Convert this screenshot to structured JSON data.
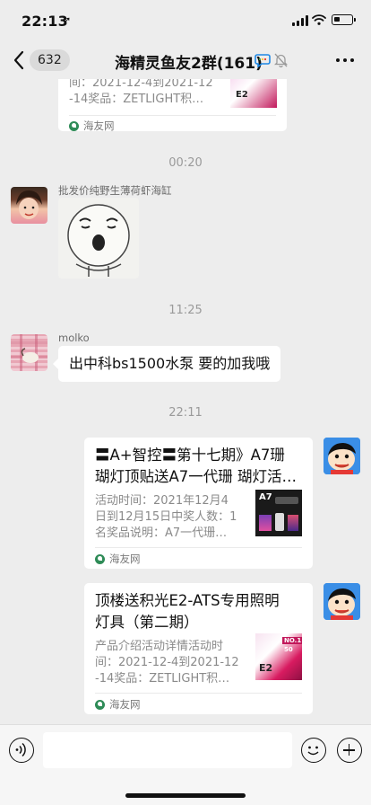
{
  "status_bar": {
    "time": "22:13",
    "location_icon": "location-arrow-icon",
    "signal_icon": "cellular-signal-icon",
    "wifi_icon": "wifi-icon",
    "battery_icon": "battery-icon"
  },
  "nav": {
    "back_icon": "chevron-left-icon",
    "unread_count": "632",
    "title": "海精灵鱼友2群(161)",
    "chat_icon": "group-chat-icon",
    "mute_icon": "mute-bell-icon",
    "more_icon": "more-dots-icon"
  },
  "messages": {
    "top_card": {
      "desc_line1": "间：2021-12-4到2021-12",
      "desc_line2": "-14奖品：ZETLIGHT积…",
      "source": "海友网"
    },
    "time1": "00:20",
    "sticker_msg": {
      "sender": "批发价纯野生薄荷虾海缸",
      "sticker": "crying-face-sticker"
    },
    "time2": "11:25",
    "text_msg": {
      "sender": "molko",
      "text": "出中科bs1500水泵 要的加我哦"
    },
    "time3": "22:11",
    "card_a7": {
      "title_line1": "〓A+智控〓第十七期》A7珊",
      "title_line2": "瑚灯顶贴送A7一代珊 瑚灯活…",
      "desc_line1": "活动时间：2021年12月4",
      "desc_line2": "日到12月15日中奖人数：1",
      "desc_line3": "名奖品说明：A7一代珊…",
      "thumb_label": "A7",
      "source": "海友网"
    },
    "card_e2": {
      "title_line1": "顶楼送积光E2-ATS专用照明",
      "title_line2": "灯具（第二期）",
      "desc_line1": "产品介绍活动详情活动时",
      "desc_line2": "间：2021-12-4到2021-12",
      "desc_line3": "-14奖品：ZETLIGHT积…",
      "thumb_label": "E2",
      "thumb_badge_line1": "NO.1",
      "thumb_badge_line2": "50",
      "source": "海友网"
    }
  },
  "input_bar": {
    "voice_icon": "voice-icon",
    "emoji_icon": "emoji-icon",
    "plus_icon": "plus-icon",
    "input_value": ""
  },
  "colors": {
    "background": "#ededed",
    "bubble": "#ffffff",
    "muted_text": "#8a8a8a"
  }
}
